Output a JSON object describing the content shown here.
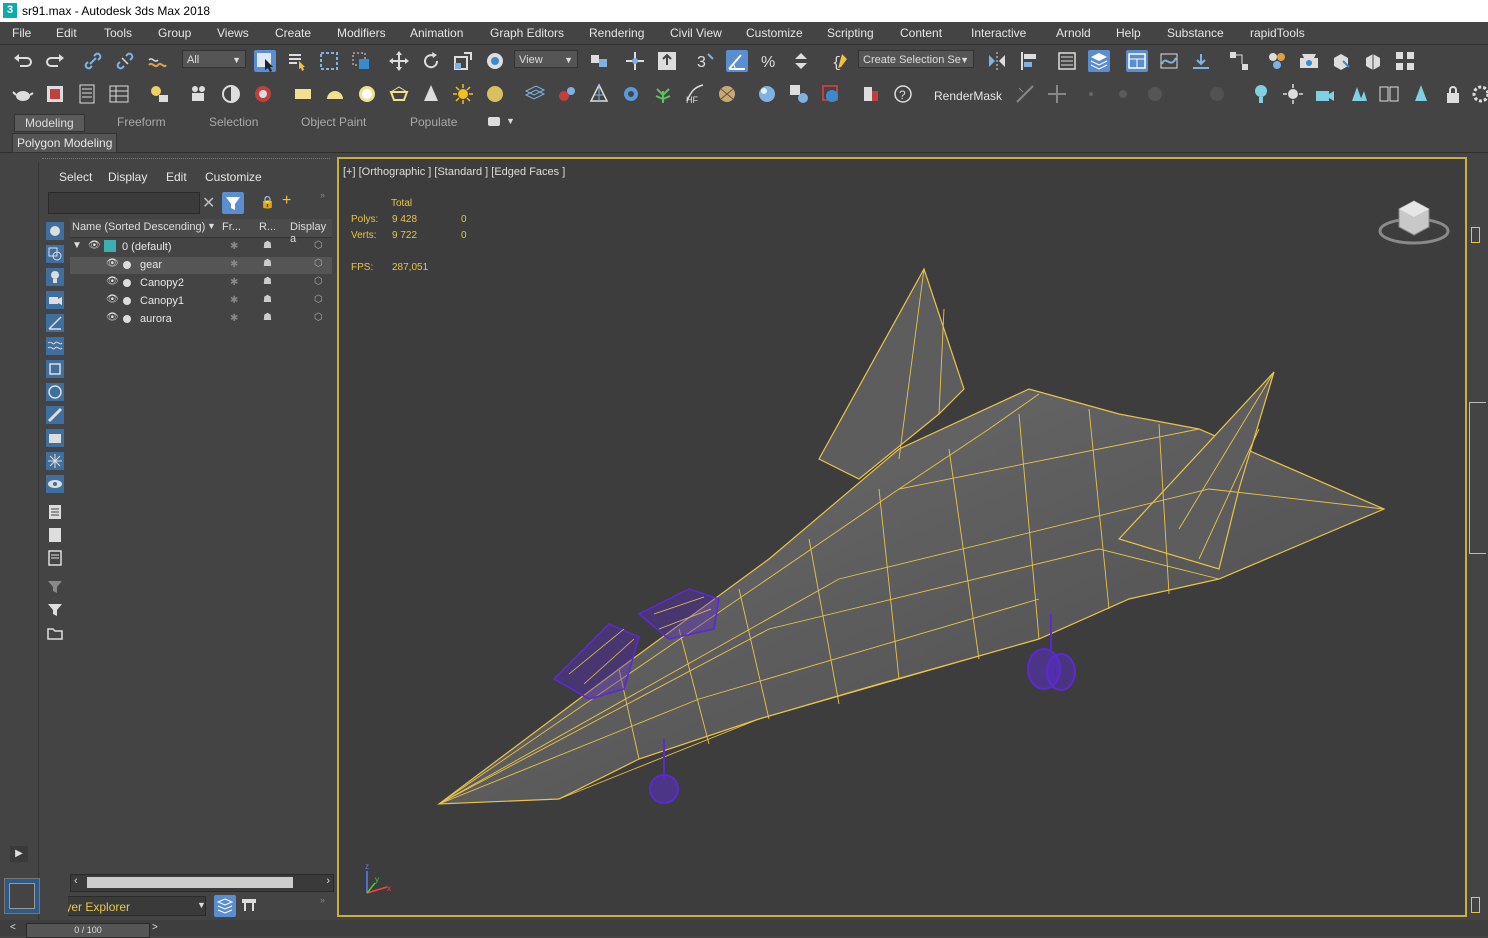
{
  "window": {
    "title_file": "sr91.max",
    "title_app": " - Autodesk 3ds Max 2018",
    "logo": "3"
  },
  "menu": [
    "File",
    "Edit",
    "Tools",
    "Group",
    "Views",
    "Create",
    "Modifiers",
    "Animation",
    "Graph Editors",
    "Rendering",
    "Civil View",
    "Customize",
    "Scripting",
    "Content",
    "Interactive",
    "Arnold",
    "Help",
    "Substance",
    "rapidTools"
  ],
  "toolbar": {
    "filter_value": "All",
    "refcoord_value": "View",
    "selection_set_value": "Create Selection Se",
    "render_mask_label": "RenderMask",
    "snap_label": "3"
  },
  "ribbon": {
    "tabs": [
      "Modeling",
      "Freeform",
      "Selection",
      "Object Paint",
      "Populate"
    ],
    "active": "Modeling",
    "panel_label": "Polygon Modeling"
  },
  "scene_explorer": {
    "menu": [
      "Select",
      "Display",
      "Edit",
      "Customize"
    ],
    "columns": {
      "name": "Name (Sorted Descending)",
      "sort_arrow": "▼",
      "frozen": "Fr...",
      "render": "R...",
      "display": "Display a"
    },
    "layer": "0 (default)",
    "objects": [
      "gear",
      "Canopy2",
      "Canopy1",
      "aurora"
    ],
    "layer_explorer": "Layer Explorer"
  },
  "viewport": {
    "label": "[+] [Orthographic ] [Standard ] [Edged Faces ]",
    "stats_header": "Total",
    "polys_label": "Polys:",
    "polys_total": "9 428",
    "polys_sel": "0",
    "verts_label": "Verts:",
    "verts_total": "9 722",
    "verts_sel": "0",
    "fps_label": "FPS:",
    "fps_value": "287,051",
    "axis_z": "z",
    "axis_x": "x",
    "axis_y": "y"
  },
  "time_slider": {
    "value": "0 / 100"
  },
  "colors": {
    "selection_yellow": "#e8c44a",
    "selected_purple": "#5b2bd0",
    "highlight_blue": "#5b8ed0"
  }
}
